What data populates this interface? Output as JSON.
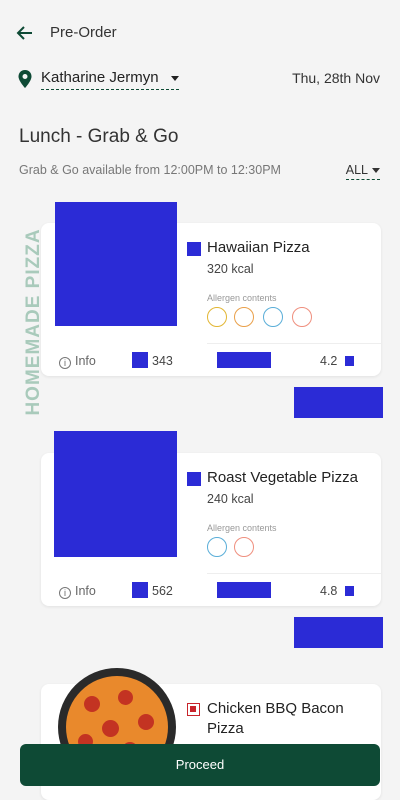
{
  "header": {
    "title": "Pre-Order",
    "back_icon": "back-arrow-icon"
  },
  "location": {
    "name": "Katharine Jermyn",
    "date": "Thu, 28th Nov"
  },
  "meal": {
    "title": "Lunch - Grab & Go",
    "subtitle": "Grab & Go available from 12:00PM to 12:30PM",
    "filter": "ALL"
  },
  "category_label": "HOMEMADE PIZZA",
  "items": [
    {
      "name": "Hawaiian Pizza",
      "kcal": "320 kcal",
      "allergen_label": "Allergen contents",
      "info": "Info",
      "count": "343",
      "rating": "4.2"
    },
    {
      "name": "Roast Vegetable Pizza",
      "kcal": "240 kcal",
      "allergen_label": "Allergen contents",
      "info": "Info",
      "count": "562",
      "rating": "4.8"
    },
    {
      "name": "Chicken BBQ Bacon Pizza"
    }
  ],
  "proceed_label": "Proceed",
  "colors": {
    "brand": "#0e4a35",
    "placeholder": "#2b2bd6",
    "category": "#a9cabb"
  }
}
